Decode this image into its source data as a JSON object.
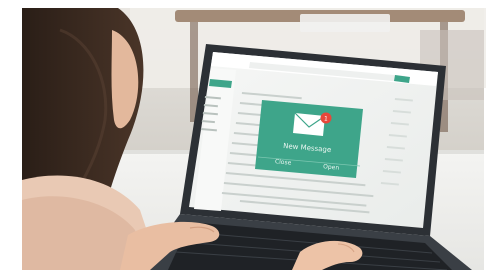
{
  "photo": {
    "subject": "woman using laptop with email notification",
    "colors": {
      "accent": "#3ea58a",
      "badge": "#e8473a",
      "screen": "#f3f5f4",
      "laptop_body": "#2f3338",
      "keyboard": "#1f2226"
    }
  },
  "notification": {
    "title": "New Message",
    "badge_count": "1",
    "left_action": "Close",
    "right_action": "Open"
  }
}
